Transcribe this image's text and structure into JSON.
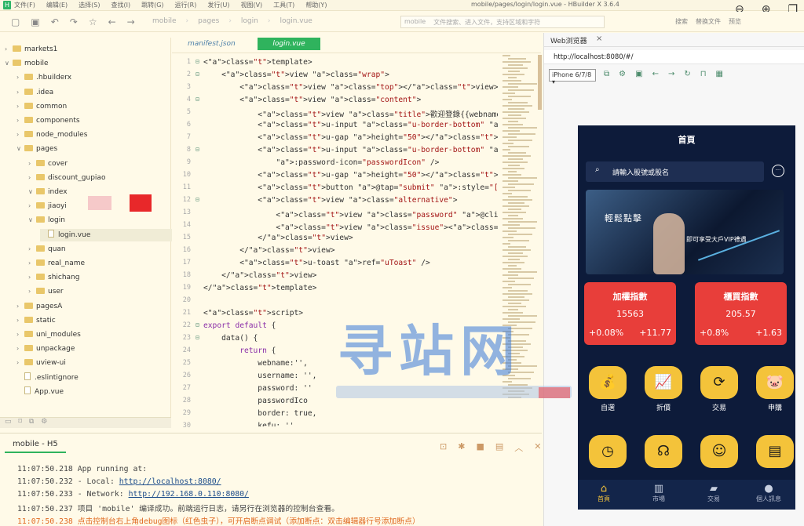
{
  "app": {
    "menu": [
      "文件(F)",
      "编辑(E)",
      "选择(S)",
      "查找(I)",
      "跳转(G)",
      "运行(R)",
      "发行(U)",
      "视图(V)",
      "工具(T)",
      "帮助(Y)"
    ],
    "window_title": "mobile/pages/login/login.vue - HBuilder X 3.6.4",
    "breadcrumb": [
      "mobile",
      "pages",
      "login",
      "login.vue"
    ],
    "search_placeholder": "文件搜索、进入文件，支持区域和字符",
    "search_scope": "mobile",
    "toolbar_right": [
      "搜索",
      "替换文件",
      "预览"
    ]
  },
  "sidebar": {
    "items": [
      {
        "label": "markets1",
        "depth": 0,
        "type": "folder",
        "open": false
      },
      {
        "label": "mobile",
        "depth": 0,
        "type": "folder",
        "open": true
      },
      {
        "label": ".hbuilderx",
        "depth": 1,
        "type": "folder",
        "open": false
      },
      {
        "label": ".idea",
        "depth": 1,
        "type": "folder",
        "open": false
      },
      {
        "label": "common",
        "depth": 1,
        "type": "folder",
        "open": false
      },
      {
        "label": "components",
        "depth": 1,
        "type": "folder",
        "open": false
      },
      {
        "label": "node_modules",
        "depth": 1,
        "type": "folder",
        "open": false
      },
      {
        "label": "pages",
        "depth": 1,
        "type": "folder",
        "open": true
      },
      {
        "label": "cover",
        "depth": 2,
        "type": "folder",
        "open": false
      },
      {
        "label": "discount_gupiao",
        "depth": 2,
        "type": "folder",
        "open": false
      },
      {
        "label": "index",
        "depth": 2,
        "type": "folder",
        "open": true
      },
      {
        "label": "jiaoyi",
        "depth": 2,
        "type": "folder",
        "open": false
      },
      {
        "label": "login",
        "depth": 2,
        "type": "folder",
        "open": true
      },
      {
        "label": "login.vue",
        "depth": 3,
        "type": "file",
        "selected": true
      },
      {
        "label": "quan",
        "depth": 2,
        "type": "folder",
        "open": false
      },
      {
        "label": "real_name",
        "depth": 2,
        "type": "folder",
        "open": false
      },
      {
        "label": "shichang",
        "depth": 2,
        "type": "folder",
        "open": false
      },
      {
        "label": "user",
        "depth": 2,
        "type": "folder",
        "open": false
      },
      {
        "label": "pagesA",
        "depth": 1,
        "type": "folder",
        "open": false
      },
      {
        "label": "static",
        "depth": 1,
        "type": "folder",
        "open": false
      },
      {
        "label": "uni_modules",
        "depth": 1,
        "type": "folder",
        "open": false
      },
      {
        "label": "unpackage",
        "depth": 1,
        "type": "folder",
        "open": false
      },
      {
        "label": "uview-ui",
        "depth": 1,
        "type": "folder",
        "open": false
      },
      {
        "label": ".eslintignore",
        "depth": 1,
        "type": "file"
      },
      {
        "label": "App.vue",
        "depth": 1,
        "type": "file"
      }
    ]
  },
  "editor": {
    "tabs": [
      "manifest.json",
      "login.vue"
    ],
    "line_numbers": [
      "1",
      "2",
      "3",
      "4",
      "5",
      "6",
      "7",
      "8",
      "9",
      "10",
      "11",
      "12",
      "13",
      "14",
      "15",
      "16",
      "17",
      "18",
      "19",
      "20",
      "21",
      "22",
      "23",
      "24",
      "25",
      "26",
      "27",
      "28",
      "29",
      "30"
    ],
    "lines": [
      "<template>",
      "    <view class=\"wrap\">",
      "        <view class=\"top\"></view>",
      "        <view class=\"content\">",
      "            <view class=\"title\">歡迎登錄{{webname}}</view>",
      "            <u-input class=\"u-border-bottom\" type=\"text\" :",
      "            <u-gap height=\"50\"></u-gap>",
      "            <u-input class=\"u-border-bottom\" type=\"passwor",
      "                :password-icon=\"passwordIcon\" />",
      "            <u-gap height=\"50\"></u-gap>",
      "            <button @tap=\"submit\" :style=\"[inputStyle]\" cl",
      "            <view class=\"alternative\">",
      "                <view class=\"password\" @click=\"goZhuce\">立",
      "                <view class=\"issue\"><a :href=\"kefu\">遇到問題",
      "            </view>",
      "        </view>",
      "        <u-toast ref=\"uToast\" />",
      "    </view>",
      "</template>",
      "",
      "<script>",
      "export default {",
      "    data() {",
      "        return {",
      "            webname:'',",
      "            username: '',",
      "            password: ''",
      "            passwordIco",
      "            border: true,",
      "            kefu: ''"
    ]
  },
  "console": {
    "tab": "mobile - H5",
    "logs": [
      {
        "time": "11:07:50.218",
        "text": "App running at:"
      },
      {
        "time": "11:07:50.232",
        "text": "- Local:   ",
        "link": "http://localhost:8080/"
      },
      {
        "time": "11:07:50.233",
        "text": "- Network: ",
        "link": "http://192.168.0.110:8080/"
      },
      {
        "time": "11:07:50.237",
        "text": "项目 'mobile' 编译成功。前端运行日志，请另行在浏览器的控制台查看。"
      },
      {
        "time": "11:07:50.238",
        "text": "点击控制台右上角debug图标（红色虫子），可开启断点调试（添加断点：双击编辑器行号添加断点）",
        "warn": true
      }
    ]
  },
  "browser": {
    "tab_label": "Web浏览器",
    "url": "http://localhost:8080/#/",
    "device": "iPhone 6/7/8"
  },
  "phone": {
    "title": "首頁",
    "search_placeholder": "請輸入股號或股名",
    "banner_text": "輕鬆點擊",
    "banner_sub": "即可享受大戶VIP禮遇",
    "cards": [
      {
        "name": "加權指數",
        "value": "15563",
        "pct": "+0.08%",
        "chg": "+11.77"
      },
      {
        "name": "櫃買指數",
        "value": "205.57",
        "pct": "+0.8%",
        "chg": "+1.63"
      }
    ],
    "icons_row1": [
      {
        "label": "自選",
        "icon": "money-bag-icon",
        "glyph": "💰"
      },
      {
        "label": "折價",
        "icon": "chart-up-icon",
        "glyph": "📈"
      },
      {
        "label": "交易",
        "icon": "exchange-icon",
        "glyph": "⟳"
      },
      {
        "label": "申購",
        "icon": "piggy-bank-icon",
        "glyph": "🐷"
      }
    ],
    "icons_row2": [
      {
        "label": "",
        "icon": "clock-icon",
        "glyph": "◷"
      },
      {
        "label": "",
        "icon": "support-icon",
        "glyph": "☊"
      },
      {
        "label": "",
        "icon": "user-icon",
        "glyph": "☺"
      },
      {
        "label": "",
        "icon": "news-icon",
        "glyph": "▤"
      }
    ],
    "nav": [
      {
        "label": "首頁",
        "icon": "home-icon",
        "glyph": "⌂",
        "active": true
      },
      {
        "label": "市場",
        "icon": "market-icon",
        "glyph": "▥"
      },
      {
        "label": "交易",
        "icon": "trade-icon",
        "glyph": "▰"
      },
      {
        "label": "個人訊息",
        "icon": "profile-icon",
        "glyph": "●"
      }
    ]
  },
  "watermark": {
    "text": "寻站网"
  }
}
